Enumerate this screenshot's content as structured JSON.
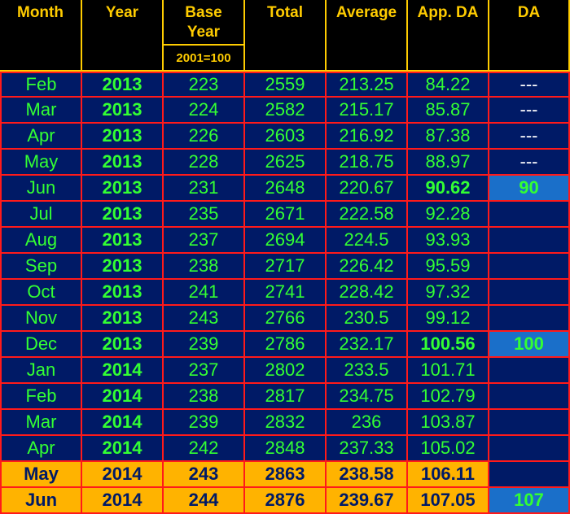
{
  "headers": {
    "month": "Month",
    "year": "Year",
    "base_year": "Base Year",
    "base_year_sub": "2001=100",
    "total": "Total",
    "average": "Average",
    "app_da": "App. DA",
    "da": "DA"
  },
  "rows": [
    {
      "month": "Feb",
      "year": "2013",
      "base": "223",
      "total": "2559",
      "avg": "213.25",
      "appda": "84.22",
      "da": "---",
      "appda_bold": false,
      "da_box": false,
      "highlight": false
    },
    {
      "month": "Mar",
      "year": "2013",
      "base": "224",
      "total": "2582",
      "avg": "215.17",
      "appda": "85.87",
      "da": "---",
      "appda_bold": false,
      "da_box": false,
      "highlight": false
    },
    {
      "month": "Apr",
      "year": "2013",
      "base": "226",
      "total": "2603",
      "avg": "216.92",
      "appda": "87.38",
      "da": "---",
      "appda_bold": false,
      "da_box": false,
      "highlight": false
    },
    {
      "month": "May",
      "year": "2013",
      "base": "228",
      "total": "2625",
      "avg": "218.75",
      "appda": "88.97",
      "da": "---",
      "appda_bold": false,
      "da_box": false,
      "highlight": false
    },
    {
      "month": "Jun",
      "year": "2013",
      "base": "231",
      "total": "2648",
      "avg": "220.67",
      "appda": "90.62",
      "da": "90",
      "appda_bold": true,
      "da_box": true,
      "highlight": false
    },
    {
      "month": "Jul",
      "year": "2013",
      "base": "235",
      "total": "2671",
      "avg": "222.58",
      "appda": "92.28",
      "da": "",
      "appda_bold": false,
      "da_box": false,
      "highlight": false
    },
    {
      "month": "Aug",
      "year": "2013",
      "base": "237",
      "total": "2694",
      "avg": "224.5",
      "appda": "93.93",
      "da": "",
      "appda_bold": false,
      "da_box": false,
      "highlight": false
    },
    {
      "month": "Sep",
      "year": "2013",
      "base": "238",
      "total": "2717",
      "avg": "226.42",
      "appda": "95.59",
      "da": "",
      "appda_bold": false,
      "da_box": false,
      "highlight": false
    },
    {
      "month": "Oct",
      "year": "2013",
      "base": "241",
      "total": "2741",
      "avg": "228.42",
      "appda": "97.32",
      "da": "",
      "appda_bold": false,
      "da_box": false,
      "highlight": false
    },
    {
      "month": "Nov",
      "year": "2013",
      "base": "243",
      "total": "2766",
      "avg": "230.5",
      "appda": "99.12",
      "da": "",
      "appda_bold": false,
      "da_box": false,
      "highlight": false
    },
    {
      "month": "Dec",
      "year": "2013",
      "base": "239",
      "total": "2786",
      "avg": "232.17",
      "appda": "100.56",
      "da": "100",
      "appda_bold": true,
      "da_box": true,
      "highlight": false
    },
    {
      "month": "Jan",
      "year": "2014",
      "base": "237",
      "total": "2802",
      "avg": "233.5",
      "appda": "101.71",
      "da": "",
      "appda_bold": false,
      "da_box": false,
      "highlight": false
    },
    {
      "month": "Feb",
      "year": "2014",
      "base": "238",
      "total": "2817",
      "avg": "234.75",
      "appda": "102.79",
      "da": "",
      "appda_bold": false,
      "da_box": false,
      "highlight": false
    },
    {
      "month": "Mar",
      "year": "2014",
      "base": "239",
      "total": "2832",
      "avg": "236",
      "appda": "103.87",
      "da": "",
      "appda_bold": false,
      "da_box": false,
      "highlight": false
    },
    {
      "month": "Apr",
      "year": "2014",
      "base": "242",
      "total": "2848",
      "avg": "237.33",
      "appda": "105.02",
      "da": "",
      "appda_bold": false,
      "da_box": false,
      "highlight": false
    },
    {
      "month": "May",
      "year": "2014",
      "base": "243",
      "total": "2863",
      "avg": "238.58",
      "appda": "106.11",
      "da": "",
      "appda_bold": false,
      "da_box": false,
      "highlight": true
    },
    {
      "month": "Jun",
      "year": "2014",
      "base": "244",
      "total": "2876",
      "avg": "239.67",
      "appda": "107.05",
      "da": "107",
      "appda_bold": false,
      "da_box": true,
      "highlight": true
    }
  ],
  "colors": {
    "background": "#000000",
    "cell_bg": "#001a66",
    "grid_red": "#ff1a1a",
    "header_gold": "#ffcc00",
    "text_green": "#33ff33",
    "highlight_bg": "#ffb300",
    "da_box_bg": "#1a6fc9"
  }
}
